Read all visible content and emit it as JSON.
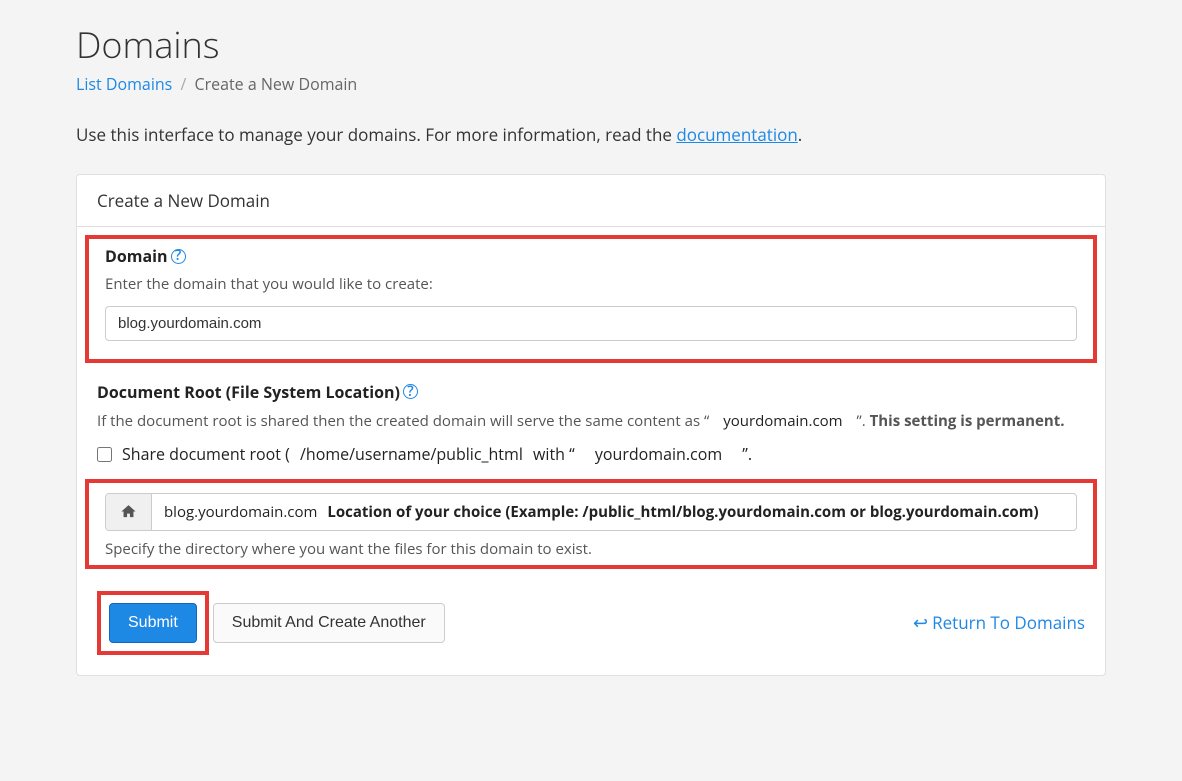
{
  "page": {
    "title": "Domains",
    "breadcrumb": {
      "list_label": "List Domains",
      "current": "Create a New Domain"
    },
    "intro_prefix": "Use this interface to manage your domains. For more information, read the ",
    "intro_link": "documentation",
    "intro_suffix": "."
  },
  "panel": {
    "title": "Create a New Domain"
  },
  "domain": {
    "label": "Domain",
    "hint": "Enter the domain that you would like to create:",
    "value": "blog.yourdomain.com"
  },
  "docroot": {
    "label": "Document Root (File System Location)",
    "desc_prefix": "If the document root is shared then the created domain will serve the same content as “",
    "desc_domain": "yourdomain.com",
    "desc_mid": "”. ",
    "desc_strong": "This setting is permanent.",
    "share": {
      "prefix": "Share document root (",
      "path": "/home/username/public_html",
      "mid": "with “",
      "domain": "yourdomain.com",
      "suffix": "”."
    },
    "input_value": "blog.yourdomain.com",
    "example": "Location of your choice (Example: /public_html/blog.yourdomain.com or blog.yourdomain.com)",
    "dir_hint": "Specify the directory where you want the files for this domain to exist."
  },
  "buttons": {
    "submit": "Submit",
    "submit_another": "Submit And Create Another",
    "return": "Return To Domains"
  }
}
